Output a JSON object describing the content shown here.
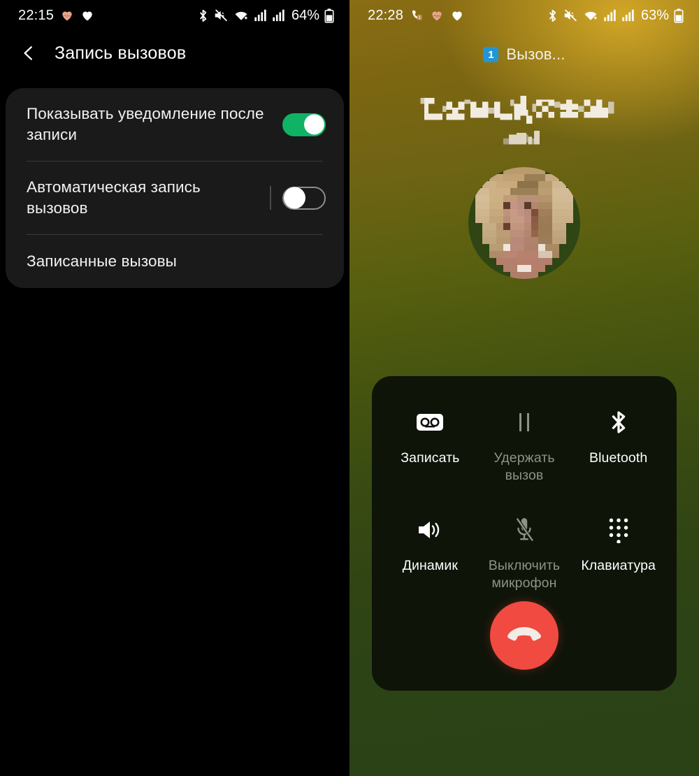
{
  "left_screen": {
    "status_bar": {
      "time": "22:15",
      "battery_percent": "64%",
      "left_icons": [
        "heart-rate-icon",
        "heart-icon"
      ],
      "right_icons": [
        "bluetooth-icon",
        "sound-muted-icon",
        "wifi-icon",
        "signal-sim1-icon",
        "signal-sim2-icon",
        "battery-icon"
      ]
    },
    "nav": {
      "back_icon": "back-chevron-icon",
      "title": "Запись вызовов"
    },
    "settings": [
      {
        "label": "Показывать уведомление после записи",
        "control": "toggle",
        "state": "on",
        "accent": "#10b265"
      },
      {
        "label": "Автоматическая запись вызовов",
        "control": "toggle",
        "state": "off",
        "accent": "#8c8c8c"
      },
      {
        "label": "Записанные вызовы",
        "control": "none",
        "state": "",
        "accent": ""
      }
    ]
  },
  "right_screen": {
    "status_bar": {
      "time": "22:28",
      "battery_percent": "63%",
      "left_icons": [
        "call-badge-icon",
        "heart-rate-icon",
        "heart-icon"
      ],
      "right_icons": [
        "bluetooth-icon",
        "sound-muted-icon",
        "wifi-icon",
        "signal-sim1-icon",
        "signal-sim2-icon",
        "battery-icon"
      ]
    },
    "call_status": {
      "badge": "1",
      "badge_color": "#2196d6",
      "text": "Вызов..."
    },
    "contact": {
      "name": "[скрыто]",
      "name_redacted": true,
      "subtitle": "[скрыто]",
      "subtitle_redacted": true,
      "avatar": "contact-photo-pixelated"
    },
    "controls": [
      {
        "label": "Записать",
        "icon": "voicemail-record-icon",
        "state": "enabled"
      },
      {
        "label": "Удержать вызов",
        "icon": "pause-hold-icon",
        "state": "disabled"
      },
      {
        "label": "Bluetooth",
        "icon": "bluetooth-icon",
        "state": "enabled"
      },
      {
        "label": "Динамик",
        "icon": "speaker-icon",
        "state": "enabled"
      },
      {
        "label": "Выключить микрофон",
        "icon": "microphone-muted-icon",
        "state": "disabled"
      },
      {
        "label": "Клавиатура",
        "icon": "dialpad-icon",
        "state": "enabled"
      }
    ],
    "end_call": {
      "icon": "end-call-handset-icon",
      "color": "#f04a41"
    },
    "annotation": {
      "shape": "hand-drawn-circle",
      "color": "#e8b63c",
      "targets": "Записать"
    }
  }
}
